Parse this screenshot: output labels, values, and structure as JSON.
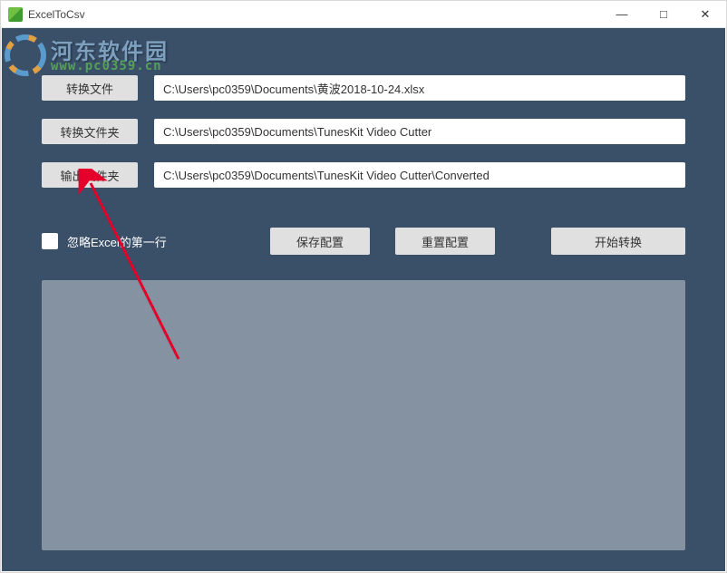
{
  "window": {
    "title": "ExcelToCsv",
    "minimize": "—",
    "maximize": "□",
    "close": "✕"
  },
  "watermark": {
    "line1": "河东软件园",
    "line2": "www.pc0359.cn"
  },
  "rows": {
    "convert_file": {
      "button": "转换文件",
      "path": "C:\\Users\\pc0359\\Documents\\黄波2018-10-24.xlsx"
    },
    "convert_folder": {
      "button": "转换文件夹",
      "path": "C:\\Users\\pc0359\\Documents\\TunesKit Video Cutter"
    },
    "output_folder": {
      "button": "输出文件夹",
      "path": "C:\\Users\\pc0359\\Documents\\TunesKit Video Cutter\\Converted"
    }
  },
  "options": {
    "ignore_first_row": "忽略Excel的第一行",
    "save_config": "保存配置",
    "reset_config": "重置配置",
    "start_convert": "开始转换"
  }
}
